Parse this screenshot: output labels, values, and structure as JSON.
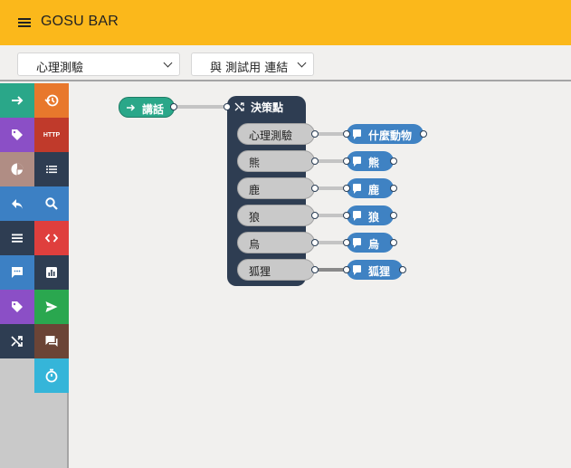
{
  "app": {
    "title": "GOSU BAR"
  },
  "toolbar": {
    "flow_select": {
      "value": "心理測驗"
    },
    "channel_select": {
      "value": "與 測試用 連結"
    }
  },
  "palette": {
    "tools": [
      {
        "name": "arrow-right-icon",
        "color": "#2aa789"
      },
      {
        "name": "history-icon",
        "color": "#e8782c"
      },
      {
        "name": "tag-icon",
        "color": "#8b4fc6"
      },
      {
        "name": "http-icon",
        "color": "#c03a2b",
        "text": "HTTP"
      },
      {
        "name": "pie-chart-icon",
        "color": "#b08d84"
      },
      {
        "name": "list-icon",
        "color": "#2e3d52"
      },
      {
        "name": "reply-icon",
        "color": "#3c80c4"
      },
      {
        "name": "search-icon",
        "color": "#3c80c4"
      },
      {
        "name": "menu-lines-icon",
        "color": "#2e3d52"
      },
      {
        "name": "code-icon",
        "color": "#df3f3d"
      },
      {
        "name": "chat-dots-icon",
        "color": "#3c80c4"
      },
      {
        "name": "bar-chart-icon",
        "color": "#2e3d52"
      },
      {
        "name": "tag-icon-2",
        "color": "#8b4fc6"
      },
      {
        "name": "send-icon",
        "color": "#2aa74f"
      },
      {
        "name": "shuffle-icon",
        "color": "#2e3d52"
      },
      {
        "name": "forum-icon",
        "color": "#6b4436"
      },
      {
        "name": "timer-icon",
        "color": "#35b5d9"
      }
    ]
  },
  "flow": {
    "start_node": {
      "label": "講話"
    },
    "decision_node": {
      "label": "決策點"
    },
    "choices": [
      "心理測驗",
      "熊",
      "鹿",
      "狼",
      "烏",
      "狐狸"
    ],
    "outputs": [
      "什麼動物",
      "熊",
      "鹿",
      "狼",
      "烏",
      "狐狸"
    ]
  },
  "colors": {
    "topbar": "#fbb81b",
    "start_node": "#2aa789",
    "decision_node": "#2e3d52",
    "message_node": "#3f82c3"
  }
}
